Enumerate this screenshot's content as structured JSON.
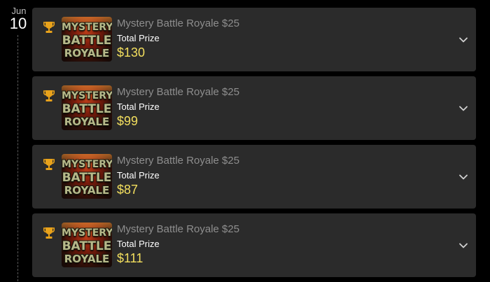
{
  "date": {
    "month": "Jun",
    "day": "10"
  },
  "colors": {
    "background": "#000000",
    "card": "#2b2b2b",
    "title": "#8e8e8e",
    "prize": "#f3df5e",
    "trophy": "#e8a21b"
  },
  "icons": {
    "trophy": "trophy-icon",
    "expand": "chevron-down-icon"
  },
  "thumbnail": {
    "line1": "MYSTERY",
    "line2": "BATTLE",
    "line3": "ROYALE"
  },
  "cards": [
    {
      "title": "Mystery Battle Royale $25",
      "prize_label": "Total Prize",
      "prize_value": "$130"
    },
    {
      "title": "Mystery Battle Royale $25",
      "prize_label": "Total Prize",
      "prize_value": "$99"
    },
    {
      "title": "Mystery Battle Royale $25",
      "prize_label": "Total Prize",
      "prize_value": "$87"
    },
    {
      "title": "Mystery Battle Royale $25",
      "prize_label": "Total Prize",
      "prize_value": "$111"
    }
  ]
}
